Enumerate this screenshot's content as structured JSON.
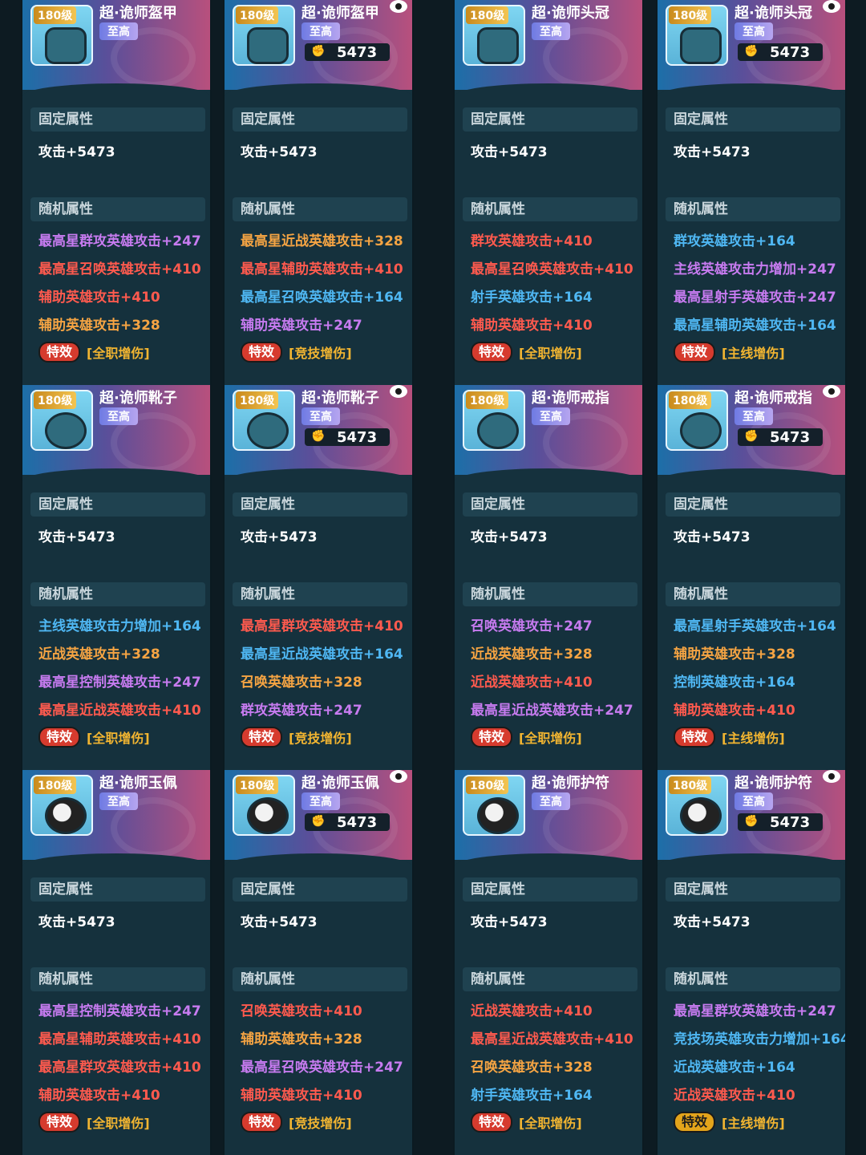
{
  "labels": {
    "fixed": "固定属性",
    "random": "随机属性",
    "effect": "特效"
  },
  "colors": {
    "purple": "#c77bf0",
    "red": "#ff5a4e",
    "orange": "#f5a443",
    "blue": "#4fb7f3",
    "white": "#ffffff",
    "gold": "#f2b531"
  },
  "cards": [
    {
      "level": "180级",
      "name": "超·诡师盔甲",
      "rank": "至高",
      "power": "",
      "locked": false,
      "icon": "armor-icon",
      "fixed": "攻击+5473",
      "stats": [
        {
          "text": "最高星群攻英雄攻击+247",
          "color": "purple"
        },
        {
          "text": "最高星召唤英雄攻击+410",
          "color": "red"
        },
        {
          "text": "辅助英雄攻击+410",
          "color": "red"
        },
        {
          "text": "辅助英雄攻击+328",
          "color": "orange"
        }
      ],
      "effect": "[全职增伤]",
      "effect_gold": false
    },
    {
      "level": "180级",
      "name": "超·诡师盔甲",
      "rank": "至高",
      "power": "5473",
      "locked": true,
      "icon": "armor-icon",
      "fixed": "攻击+5473",
      "stats": [
        {
          "text": "最高星近战英雄攻击+328",
          "color": "orange"
        },
        {
          "text": "最高星辅助英雄攻击+410",
          "color": "red"
        },
        {
          "text": "最高星召唤英雄攻击+164",
          "color": "blue"
        },
        {
          "text": "辅助英雄攻击+247",
          "color": "purple"
        }
      ],
      "effect": "[竞技增伤]",
      "effect_gold": false
    },
    {
      "level": "180级",
      "name": "超·诡师头冠",
      "rank": "至高",
      "power": "",
      "locked": false,
      "icon": "crown-icon",
      "fixed": "攻击+5473",
      "stats": [
        {
          "text": "群攻英雄攻击+410",
          "color": "red"
        },
        {
          "text": "最高星召唤英雄攻击+410",
          "color": "red"
        },
        {
          "text": "射手英雄攻击+164",
          "color": "blue"
        },
        {
          "text": "辅助英雄攻击+410",
          "color": "red"
        }
      ],
      "effect": "[全职增伤]",
      "effect_gold": false
    },
    {
      "level": "180级",
      "name": "超·诡师头冠",
      "rank": "至高",
      "power": "5473",
      "locked": true,
      "icon": "crown-icon",
      "fixed": "攻击+5473",
      "stats": [
        {
          "text": "群攻英雄攻击+164",
          "color": "blue"
        },
        {
          "text": "主线英雄攻击力增加+247",
          "color": "purple"
        },
        {
          "text": "最高星射手英雄攻击+247",
          "color": "purple"
        },
        {
          "text": "最高星辅助英雄攻击+164",
          "color": "blue"
        }
      ],
      "effect": "[主线增伤]",
      "effect_gold": false
    },
    {
      "level": "180级",
      "name": "超·诡师靴子",
      "rank": "至高",
      "power": "",
      "locked": false,
      "icon": "boots-icon",
      "fixed": "攻击+5473",
      "stats": [
        {
          "text": "主线英雄攻击力增加+164",
          "color": "blue"
        },
        {
          "text": "近战英雄攻击+328",
          "color": "orange"
        },
        {
          "text": "最高星控制英雄攻击+247",
          "color": "purple"
        },
        {
          "text": "最高星近战英雄攻击+410",
          "color": "red"
        }
      ],
      "effect": "[全职增伤]",
      "effect_gold": false
    },
    {
      "level": "180级",
      "name": "超·诡师靴子",
      "rank": "至高",
      "power": "5473",
      "locked": true,
      "icon": "boots-icon",
      "fixed": "攻击+5473",
      "stats": [
        {
          "text": "最高星群攻英雄攻击+410",
          "color": "red"
        },
        {
          "text": "最高星近战英雄攻击+164",
          "color": "blue"
        },
        {
          "text": "召唤英雄攻击+328",
          "color": "orange"
        },
        {
          "text": "群攻英雄攻击+247",
          "color": "purple"
        }
      ],
      "effect": "[竞技增伤]",
      "effect_gold": false
    },
    {
      "level": "180级",
      "name": "超·诡师戒指",
      "rank": "至高",
      "power": "",
      "locked": false,
      "icon": "ring-icon",
      "fixed": "攻击+5473",
      "stats": [
        {
          "text": "召唤英雄攻击+247",
          "color": "purple"
        },
        {
          "text": "近战英雄攻击+328",
          "color": "orange"
        },
        {
          "text": "近战英雄攻击+410",
          "color": "red"
        },
        {
          "text": "最高星近战英雄攻击+247",
          "color": "purple"
        }
      ],
      "effect": "[全职增伤]",
      "effect_gold": false
    },
    {
      "level": "180级",
      "name": "超·诡师戒指",
      "rank": "至高",
      "power": "5473",
      "locked": true,
      "icon": "ring-icon",
      "fixed": "攻击+5473",
      "stats": [
        {
          "text": "最高星射手英雄攻击+164",
          "color": "blue"
        },
        {
          "text": "辅助英雄攻击+328",
          "color": "orange"
        },
        {
          "text": "控制英雄攻击+164",
          "color": "blue"
        },
        {
          "text": "辅助英雄攻击+410",
          "color": "red"
        }
      ],
      "effect": "[主线增伤]",
      "effect_gold": false
    },
    {
      "level": "180级",
      "name": "超·诡师玉佩",
      "rank": "至高",
      "power": "",
      "locked": false,
      "icon": "jade-pendant-icon",
      "fixed": "攻击+5473",
      "stats": [
        {
          "text": "最高星控制英雄攻击+247",
          "color": "purple"
        },
        {
          "text": "最高星辅助英雄攻击+410",
          "color": "red"
        },
        {
          "text": "最高星群攻英雄攻击+410",
          "color": "red"
        },
        {
          "text": "辅助英雄攻击+410",
          "color": "red"
        }
      ],
      "effect": "[全职增伤]",
      "effect_gold": false
    },
    {
      "level": "180级",
      "name": "超·诡师玉佩",
      "rank": "至高",
      "power": "5473",
      "locked": true,
      "icon": "jade-pendant-icon",
      "fixed": "攻击+5473",
      "stats": [
        {
          "text": "召唤英雄攻击+410",
          "color": "red"
        },
        {
          "text": "辅助英雄攻击+328",
          "color": "orange"
        },
        {
          "text": "最高星召唤英雄攻击+247",
          "color": "purple"
        },
        {
          "text": "辅助英雄攻击+410",
          "color": "red"
        }
      ],
      "effect": "[竞技增伤]",
      "effect_gold": false
    },
    {
      "level": "180级",
      "name": "超·诡师护符",
      "rank": "至高",
      "power": "",
      "locked": false,
      "icon": "amulet-icon",
      "fixed": "攻击+5473",
      "stats": [
        {
          "text": "近战英雄攻击+410",
          "color": "red"
        },
        {
          "text": "最高星近战英雄攻击+410",
          "color": "red"
        },
        {
          "text": "召唤英雄攻击+328",
          "color": "orange"
        },
        {
          "text": "射手英雄攻击+164",
          "color": "blue"
        }
      ],
      "effect": "[全职增伤]",
      "effect_gold": false
    },
    {
      "level": "180级",
      "name": "超·诡师护符",
      "rank": "至高",
      "power": "5473",
      "locked": true,
      "icon": "amulet-icon",
      "fixed": "攻击+5473",
      "stats": [
        {
          "text": "最高星群攻英雄攻击+247",
          "color": "purple"
        },
        {
          "text": "竞技场英雄攻击力增加+164",
          "color": "blue"
        },
        {
          "text": "近战英雄攻击+164",
          "color": "blue"
        },
        {
          "text": "近战英雄攻击+410",
          "color": "red"
        }
      ],
      "effect": "[主线增伤]",
      "effect_gold": true
    }
  ]
}
